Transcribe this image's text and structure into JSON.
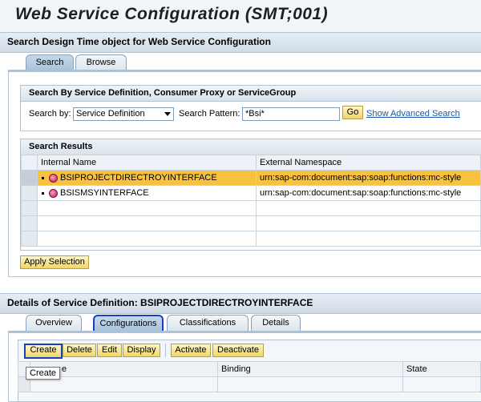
{
  "page": {
    "title": "Web Service Configuration (SMT;001)"
  },
  "search_panel": {
    "heading": "Search Design Time object for Web Service Configuration",
    "tabs": [
      {
        "label": "Search"
      },
      {
        "label": "Browse"
      }
    ],
    "criteria": {
      "heading": "Search By Service Definition, Consumer Proxy or ServiceGroup",
      "search_by_label": "Search by:",
      "search_by_value": "Service Definition",
      "pattern_label": "Search Pattern:",
      "pattern_value": "*Bsi*",
      "go_label": "Go",
      "advanced_link": "Show Advanced Search"
    },
    "results": {
      "heading": "Search Results",
      "columns": [
        "Internal Name",
        "External Namespace"
      ],
      "rows": [
        {
          "name": "BSIPROJECTDIRECTROYINTERFACE",
          "ns": "urn:sap-com:document:sap:soap:functions:mc-style"
        },
        {
          "name": "BSISMSYINTERFACE",
          "ns": "urn:sap-com:document:sap:soap:functions:mc-style"
        }
      ],
      "apply_label": "Apply Selection"
    }
  },
  "details_panel": {
    "heading": "Details of Service Definition: BSIPROJECTDIRECTROYINTERFACE",
    "tabs": [
      {
        "label": "Overview"
      },
      {
        "label": "Configurations"
      },
      {
        "label": "Classifications"
      },
      {
        "label": "Details"
      }
    ],
    "toolbar": {
      "create": "Create",
      "delete": "Delete",
      "edit": "Edit",
      "display": "Display",
      "activate": "Activate",
      "deactivate": "Deactivate"
    },
    "columns": [
      "e",
      "Binding",
      "State"
    ],
    "tooltip": "Create"
  }
}
